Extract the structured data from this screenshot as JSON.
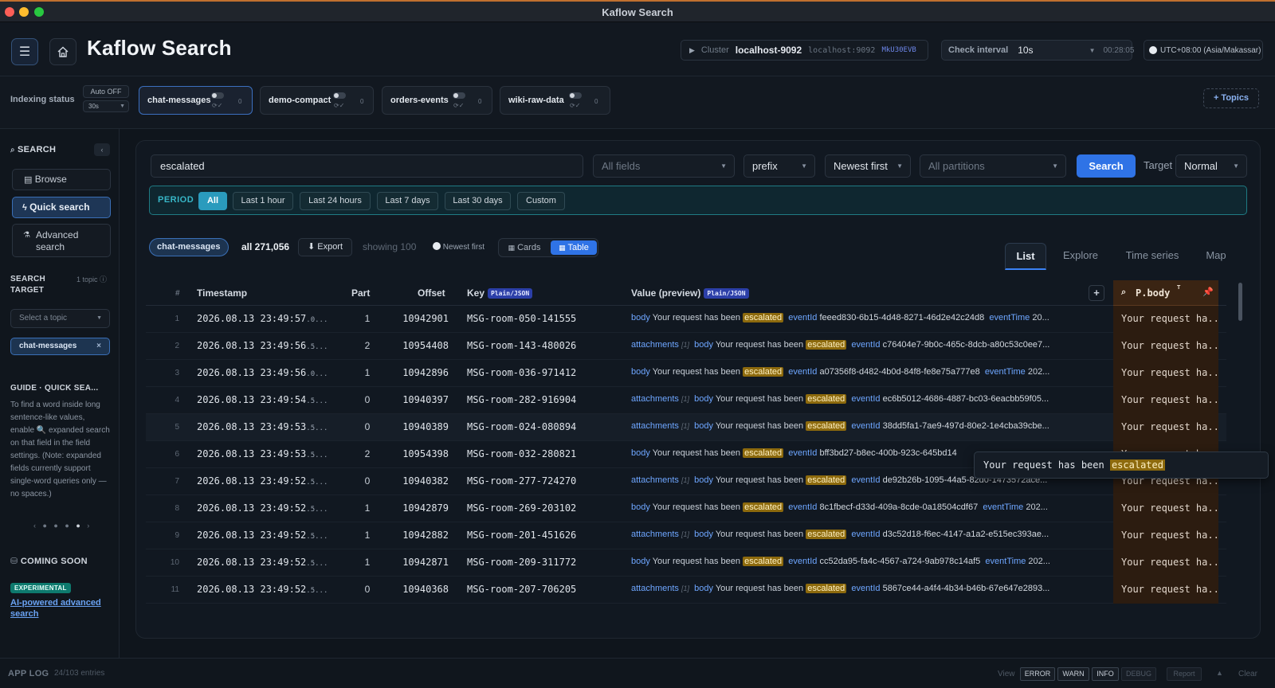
{
  "window": {
    "title": "Kaflow Search",
    "traffic_colors": [
      "#fe5f57",
      "#febc2e",
      "#28c840"
    ]
  },
  "header": {
    "app_title": "Kaflow Search",
    "cluster_label": "Cluster",
    "cluster_name": "localhost-9092",
    "cluster_host": "localhost:9092",
    "cluster_id": "MkU30EVB",
    "interval_label": "Check interval",
    "interval_value": "10s",
    "interval_timer": "00:28:05",
    "timezone": "UTC+08:00 (Asia/Makassar)"
  },
  "indexing": {
    "label": "Indexing status",
    "auto": "Auto OFF",
    "auto_interval": "30s",
    "topics": [
      {
        "name": "chat-messages",
        "count": "0",
        "active": true
      },
      {
        "name": "demo-compact",
        "count": "0",
        "active": false
      },
      {
        "name": "orders-events",
        "count": "0",
        "active": false
      },
      {
        "name": "wiki-raw-data",
        "count": "0",
        "active": false
      }
    ],
    "add_topics": "+ Topics"
  },
  "sidebar": {
    "search_title": "SEARCH",
    "browse": "Browse",
    "quick_search": "Quick search",
    "advanced_search": "Advanced search",
    "target_title": "SEARCH TARGET",
    "target_count": "1 topic",
    "select_placeholder": "Select a topic",
    "selected_topic": "chat-messages",
    "guide_title": "GUIDE · QUICK SEA...",
    "guide_text": "To find a word inside long sentence-like values, enable 🔍 expanded search on that field in the field settings. (Note: expanded fields currently support single-word queries only — no spaces.)",
    "coming_soon": "COMING SOON",
    "experimental": "EXPERIMENTAL",
    "ai_link": "AI-powered advanced search"
  },
  "search": {
    "query": "escalated",
    "fields": "All fields",
    "mode": "prefix",
    "sort": "Newest first",
    "partitions": "All partitions",
    "button": "Search",
    "target_label": "Target",
    "target_value": "Normal"
  },
  "period": {
    "label": "PERIOD",
    "options": [
      "All",
      "Last 1 hour",
      "Last 24 hours",
      "Last 7 days",
      "Last 30 days",
      "Custom"
    ],
    "active": "All"
  },
  "results": {
    "topic": "chat-messages",
    "total": "all 271,056",
    "export": "Export",
    "showing": "showing 100",
    "order": "Newest first",
    "view_cards": "Cards",
    "view_table": "Table"
  },
  "tabs": [
    "List",
    "Explore",
    "Time series",
    "Map"
  ],
  "table": {
    "headers": {
      "num": "#",
      "timestamp": "Timestamp",
      "part": "Part",
      "offset": "Offset",
      "key": "Key",
      "key_badge": "Plain/JSON",
      "value": "Value (preview)",
      "value_badge": "Plain/JSON",
      "pinned": "P.body",
      "pinned_sup": "T"
    },
    "body_label": "body",
    "body_text": "Your request has been",
    "hit": "escalated",
    "event_label": "eventId",
    "time_label": "eventTime",
    "attachments_label": "attachments",
    "attachments_count": "[1]",
    "pinned_text": "Your request ha...",
    "rows": [
      {
        "n": "1",
        "ts": "2026.08.13 23:49:57",
        "ms": ".0...",
        "part": "1",
        "offset": "10942901",
        "key": "MSG-room-050-141555",
        "att": false,
        "uuid": "feeed830-6b15-4d48-8271-46d2e42c24d8",
        "tail": "20..."
      },
      {
        "n": "2",
        "ts": "2026.08.13 23:49:56",
        "ms": ".5...",
        "part": "2",
        "offset": "10954408",
        "key": "MSG-room-143-480026",
        "att": true,
        "uuid": "c76404e7-9b0c-465c-8dcb-a80c53c0ee7...",
        "tail": ""
      },
      {
        "n": "3",
        "ts": "2026.08.13 23:49:56",
        "ms": ".0...",
        "part": "1",
        "offset": "10942896",
        "key": "MSG-room-036-971412",
        "att": false,
        "uuid": "a07356f8-d482-4b0d-84f8-fe8e75a777e8",
        "tail": "202..."
      },
      {
        "n": "4",
        "ts": "2026.08.13 23:49:54",
        "ms": ".5...",
        "part": "0",
        "offset": "10940397",
        "key": "MSG-room-282-916904",
        "att": true,
        "uuid": "ec6b5012-4686-4887-bc03-6eacbb59f05...",
        "tail": ""
      },
      {
        "n": "5",
        "ts": "2026.08.13 23:49:53",
        "ms": ".5...",
        "part": "0",
        "offset": "10940389",
        "key": "MSG-room-024-080894",
        "att": true,
        "uuid": "38dd5fa1-7ae9-497d-80e2-1e4cba39cbe...",
        "tail": ""
      },
      {
        "n": "6",
        "ts": "2026.08.13 23:49:53",
        "ms": ".5...",
        "part": "2",
        "offset": "10954398",
        "key": "MSG-room-032-280821",
        "att": false,
        "uuid": "bff3bd27-b8ec-400b-923c-645bd14",
        "tail": ""
      },
      {
        "n": "7",
        "ts": "2026.08.13 23:49:52",
        "ms": ".5...",
        "part": "0",
        "offset": "10940382",
        "key": "MSG-room-277-724270",
        "att": true,
        "uuid": "de92b26b-1095-44a5-82d0-1473572ace...",
        "tail": ""
      },
      {
        "n": "8",
        "ts": "2026.08.13 23:49:52",
        "ms": ".5...",
        "part": "1",
        "offset": "10942879",
        "key": "MSG-room-269-203102",
        "att": false,
        "uuid": "8c1fbecf-d33d-409a-8cde-0a18504cdf67",
        "tail": "202..."
      },
      {
        "n": "9",
        "ts": "2026.08.13 23:49:52",
        "ms": ".5...",
        "part": "1",
        "offset": "10942882",
        "key": "MSG-room-201-451626",
        "att": true,
        "uuid": "d3c52d18-f6ec-4147-a1a2-e515ec393ae...",
        "tail": ""
      },
      {
        "n": "10",
        "ts": "2026.08.13 23:49:52",
        "ms": ".5...",
        "part": "1",
        "offset": "10942871",
        "key": "MSG-room-209-311772",
        "att": false,
        "uuid": "cc52da95-fa4c-4567-a724-9ab978c14af5",
        "tail": "202..."
      },
      {
        "n": "11",
        "ts": "2026.08.13 23:49:52",
        "ms": ".5...",
        "part": "0",
        "offset": "10940368",
        "key": "MSG-room-207-706205",
        "att": true,
        "uuid": "5867ce44-a4f4-4b34-b46b-67e647e2893...",
        "tail": ""
      }
    ]
  },
  "tooltip": {
    "text": "Your request has been",
    "hit": "escalated"
  },
  "footer": {
    "app_log": "APP LOG",
    "entries": "24/103 entries",
    "view_label": "View",
    "levels": [
      "ERROR",
      "WARN",
      "INFO",
      "DEBUG"
    ],
    "report": "Report",
    "clear": "Clear"
  }
}
